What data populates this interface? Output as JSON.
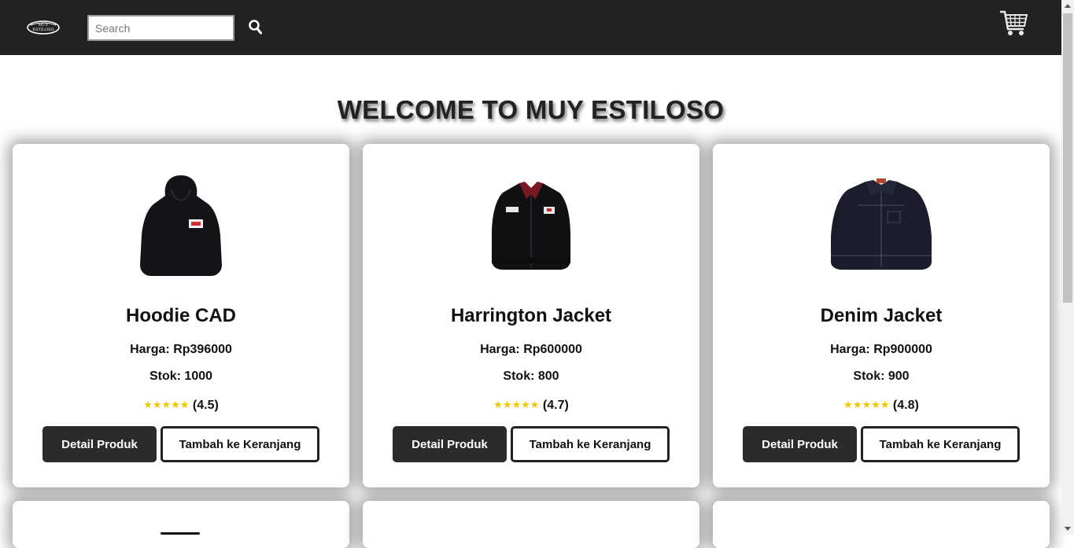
{
  "header": {
    "logo_text": "MUY ESTILOSO",
    "search_placeholder": "Search",
    "search_icon": "search-icon",
    "cart_icon": "shopping-cart-icon"
  },
  "main": {
    "welcome": "WELCOME TO MUY ESTILOSO"
  },
  "products": [
    {
      "name": "Hoodie CAD",
      "price": "Harga: Rp396000",
      "stock": "Stok: 1000",
      "stars": "★★★★★",
      "rating": "(4.5)",
      "image": "black-hoodie"
    },
    {
      "name": "Harrington Jacket",
      "price": "Harga: Rp600000",
      "stock": "Stok: 800",
      "stars": "★★★★★",
      "rating": "(4.7)",
      "image": "black-harrington-jacket"
    },
    {
      "name": "Denim Jacket",
      "price": "Harga: Rp900000",
      "stock": "Stok: 900",
      "stars": "★★★★★",
      "rating": "(4.8)",
      "image": "dark-denim-jacket"
    }
  ],
  "buttons": {
    "detail": "Detail Produk",
    "add_to_cart": "Tambah ke Keranjang"
  },
  "colors": {
    "header_bg": "#222222",
    "star": "#f5c400",
    "primary_button": "#2b2b2b"
  }
}
